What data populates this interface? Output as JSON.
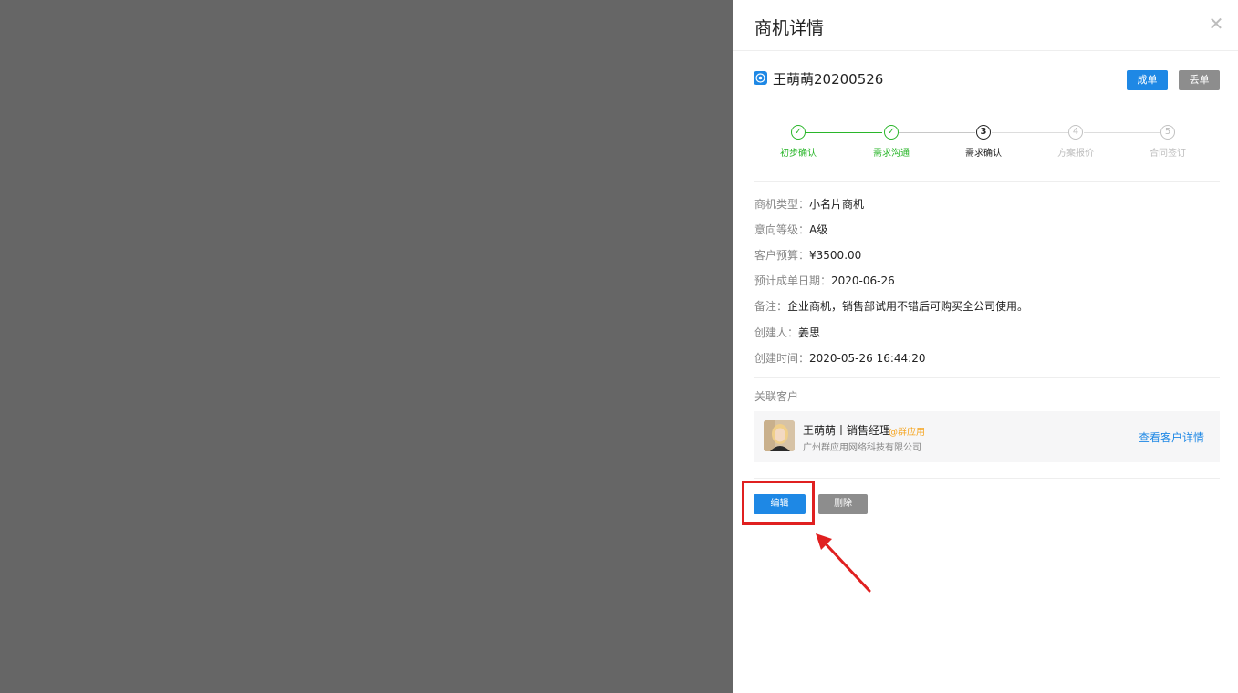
{
  "drawer": {
    "title": "商机详情",
    "close_icon": "close-icon",
    "opportunity_name": "王萌萌20200526",
    "buttons": {
      "win": "成单",
      "lose": "丢单"
    },
    "steps": [
      {
        "num": "1",
        "label": "初步确认",
        "state": "done"
      },
      {
        "num": "2",
        "label": "需求沟通",
        "state": "done"
      },
      {
        "num": "3",
        "label": "需求确认",
        "state": "active"
      },
      {
        "num": "4",
        "label": "方案报价",
        "state": "todo"
      },
      {
        "num": "5",
        "label": "合同签订",
        "state": "todo"
      }
    ],
    "info": [
      {
        "key": "商机类型：",
        "value": "小名片商机"
      },
      {
        "key": "意向等级：",
        "value": "A级"
      },
      {
        "key": "客户预算：",
        "value": "¥3500.00"
      },
      {
        "key": "预计成单日期：",
        "value": "2020-06-26"
      },
      {
        "key": "备注：",
        "value": "企业商机，销售部试用不错后可购买全公司使用。"
      },
      {
        "key": "创建人：",
        "value": "姜思"
      },
      {
        "key": "创建时间：",
        "value": "2020-05-26 16:44:20"
      }
    ],
    "related_customer": {
      "section_title": "关联客户",
      "name": "王萌萌丨销售经理",
      "tag": "@群应用",
      "company": "广州群应用网络科技有限公司",
      "link": "查看客户详情"
    },
    "actions": {
      "edit": "编辑",
      "delete": "删除"
    }
  },
  "colors": {
    "overlay": "#666666",
    "primary": "#1e88e5",
    "success": "#2ab62a",
    "annotation": "#e02020",
    "gray_button": "#8d8d8d"
  }
}
